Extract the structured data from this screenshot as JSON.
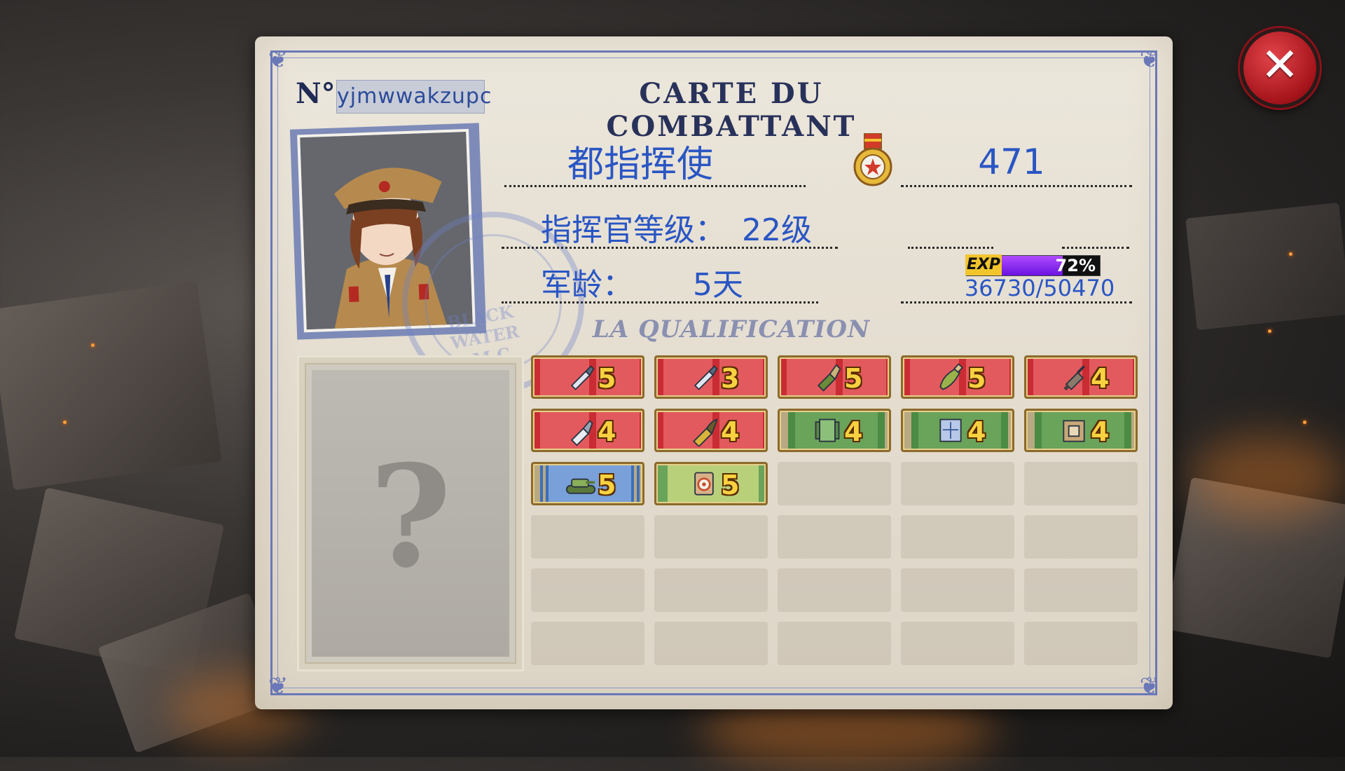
{
  "card": {
    "no_label": "N°",
    "player_id": "yjmwwakzupc",
    "title": "CARTE DU COMBATTANT",
    "rank_name": "都指挥使",
    "points": "471",
    "level_label": "指挥官等级：",
    "level_value": "22级",
    "age_label": "军龄：",
    "age_value": "5天",
    "exp": {
      "tag": "EXP",
      "percent_text": "72%",
      "fraction": 0.72,
      "value_text": "36730/50470"
    },
    "stamp_text": "BLACK WATER A.M.C",
    "qualification_title": "LA QUALIFICATION",
    "mystery_glyph": "?"
  },
  "qualifications": [
    {
      "color": "red",
      "icon": "ammo-shell-icon",
      "level": "5"
    },
    {
      "color": "red",
      "icon": "ammo-shell-icon",
      "level": "3"
    },
    {
      "color": "red",
      "icon": "rocket-shell-icon",
      "level": "5"
    },
    {
      "color": "red",
      "icon": "heavy-shell-icon",
      "level": "5"
    },
    {
      "color": "red",
      "icon": "mortar-shell-icon",
      "level": "4"
    },
    {
      "color": "red",
      "icon": "bullet-icon",
      "level": "4"
    },
    {
      "color": "red",
      "icon": "cartridge-icon",
      "level": "4"
    },
    {
      "color": "green",
      "icon": "armor-plate-icon",
      "level": "4"
    },
    {
      "color": "green",
      "icon": "blueprint-icon",
      "level": "4"
    },
    {
      "color": "green",
      "icon": "crate-icon",
      "level": "4"
    },
    {
      "color": "blue",
      "icon": "tank-icon",
      "level": "5"
    },
    {
      "color": "lime",
      "icon": "target-icon",
      "level": "5"
    }
  ],
  "grid_total_slots": 30,
  "close_button": {
    "glyph": "✕"
  },
  "colors": {
    "ink_blue": "#2a56c4",
    "frame_blue": "#6a78b8",
    "badge_red": "#c92c33",
    "badge_green": "#4b8b44",
    "close_red": "#c32028"
  }
}
